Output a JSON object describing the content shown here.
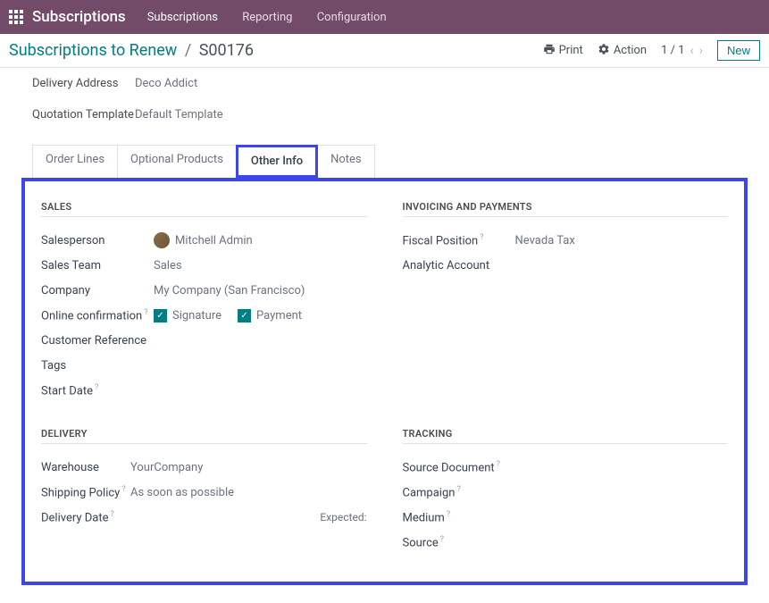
{
  "topbar": {
    "brand": "Subscriptions",
    "nav": [
      "Subscriptions",
      "Reporting",
      "Configuration"
    ]
  },
  "subbar": {
    "breadcrumb_root": "Subscriptions to Renew",
    "breadcrumb_current": "S00176",
    "print": "Print",
    "action": "Action",
    "pager": "1 / 1",
    "new_btn": "New"
  },
  "header_fields": {
    "delivery_address_lbl": "Delivery Address",
    "delivery_address_val": "Deco Addict",
    "quotation_template_lbl": "Quotation Template",
    "quotation_template_val": "Default Template"
  },
  "tabs": [
    "Order Lines",
    "Optional Products",
    "Other Info",
    "Notes"
  ],
  "sections": {
    "sales_title": "SALES",
    "invoicing_title": "INVOICING AND PAYMENTS",
    "delivery_title": "DELIVERY",
    "tracking_title": "TRACKING"
  },
  "sales": {
    "salesperson_lbl": "Salesperson",
    "salesperson_val": "Mitchell Admin",
    "sales_team_lbl": "Sales Team",
    "sales_team_val": "Sales",
    "company_lbl": "Company",
    "company_val": "My Company (San Francisco)",
    "online_conf_lbl": "Online confirmation",
    "signature_lbl": "Signature",
    "payment_lbl": "Payment",
    "customer_ref_lbl": "Customer Reference",
    "tags_lbl": "Tags",
    "start_date_lbl": "Start Date"
  },
  "invoicing": {
    "fiscal_lbl": "Fiscal Position",
    "fiscal_val": "Nevada Tax",
    "analytic_lbl": "Analytic Account"
  },
  "delivery": {
    "warehouse_lbl": "Warehouse",
    "warehouse_val": "YourCompany",
    "shipping_lbl": "Shipping Policy",
    "shipping_val": "As soon as possible",
    "delivery_date_lbl": "Delivery Date",
    "expected_lbl": "Expected:"
  },
  "tracking": {
    "source_doc_lbl": "Source Document",
    "campaign_lbl": "Campaign",
    "medium_lbl": "Medium",
    "source_lbl": "Source"
  }
}
